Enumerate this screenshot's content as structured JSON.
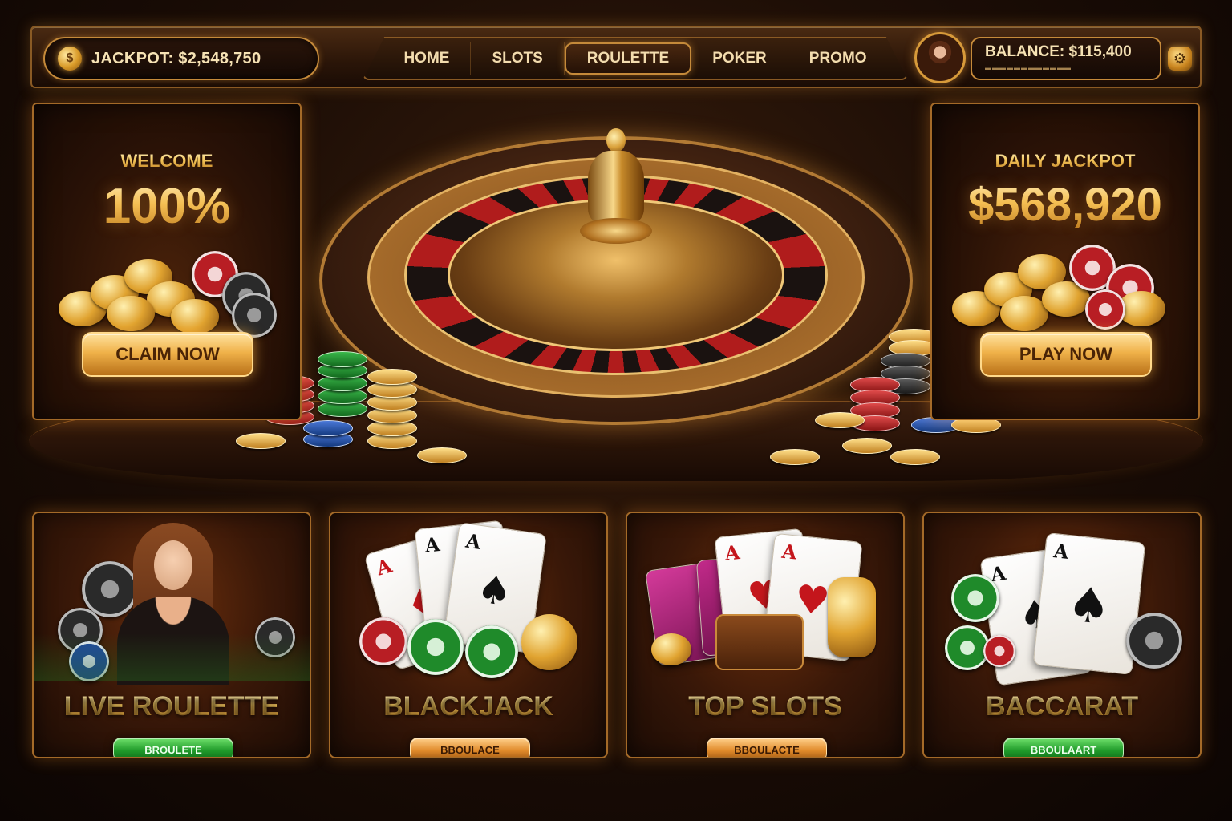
{
  "header": {
    "jackpot_label": "JACKPOT: $2,548,750",
    "nav": [
      "HOME",
      "SLOTS",
      "ROULETTE",
      "POKER",
      "PROMO"
    ],
    "active_nav": "ROULETTE",
    "balance_label": "BALANCE: $115,400"
  },
  "promo_left": {
    "kicker": "WELCOME",
    "headline": "100%",
    "cta": "CLAIM NOW"
  },
  "promo_right": {
    "kicker": "DAILY JACKPOT",
    "headline": "$568,920",
    "cta": "PLAY NOW"
  },
  "games": [
    {
      "title": "LIVE ROULETTE",
      "button": "BROULETE",
      "button_color": "green"
    },
    {
      "title": "BLACKJACK",
      "button": "BBOULACE",
      "button_color": "orange"
    },
    {
      "title": "TOP SLOTS",
      "button": "BBOULACTE",
      "button_color": "orange"
    },
    {
      "title": "BACCARAT",
      "button": "BBOULAART",
      "button_color": "green"
    }
  ],
  "colors": {
    "accent_gold": "#f0b24a",
    "background": "#1d0e06",
    "button_green": "#1f9a2a"
  },
  "icons": {
    "jackpot": "coin-icon",
    "settings": "gear-icon"
  }
}
